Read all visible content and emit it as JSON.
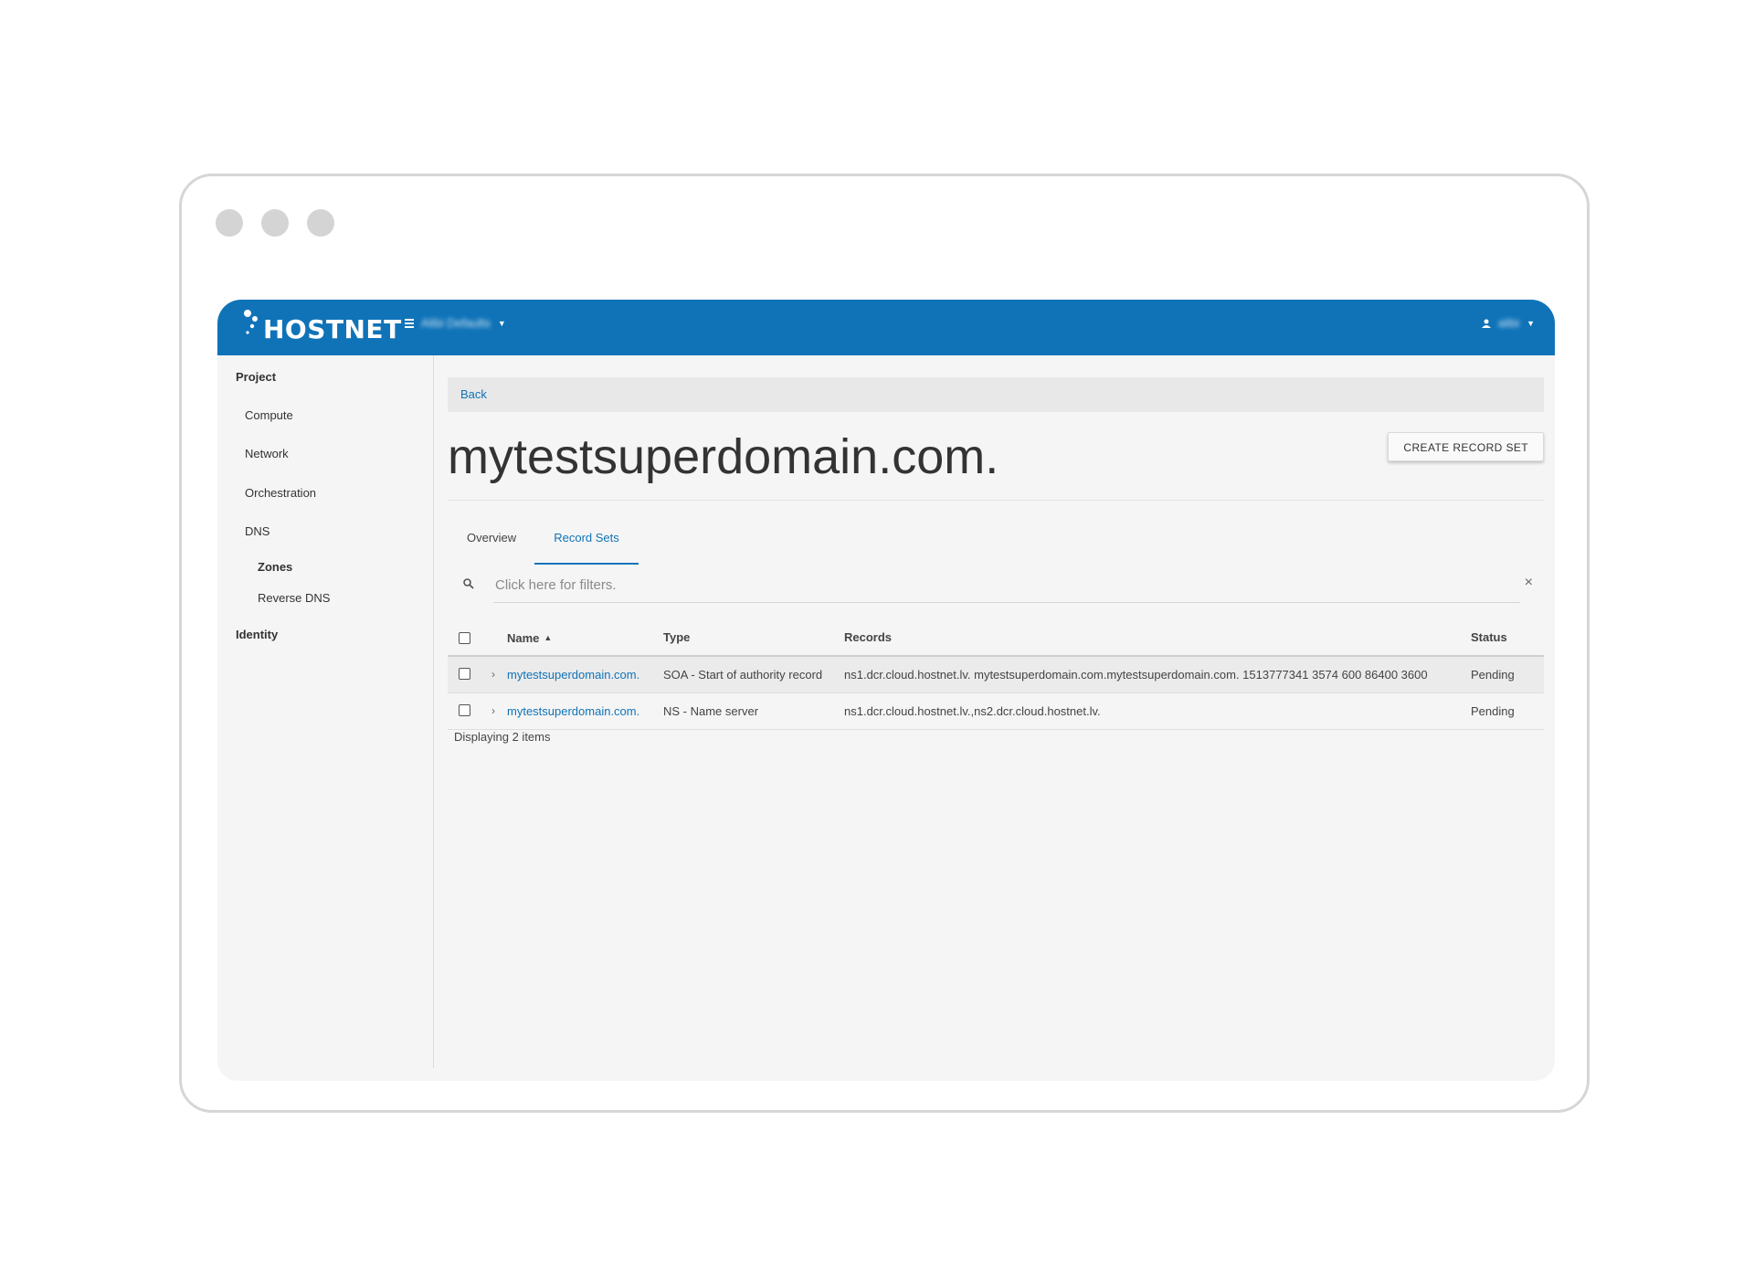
{
  "brand": {
    "name": "HOSTNET"
  },
  "topbar": {
    "project_label": "Alibi Defaults",
    "user_label": "alibi"
  },
  "sidebar": {
    "section_project": "Project",
    "items": [
      "Compute",
      "Network",
      "Orchestration",
      "DNS"
    ],
    "dns_children": [
      "Zones",
      "Reverse DNS"
    ],
    "section_identity": "Identity"
  },
  "breadcrumb": {
    "back": "Back"
  },
  "page": {
    "title": "mytestsuperdomain.com.",
    "create_button": "CREATE RECORD SET"
  },
  "tabs": [
    "Overview",
    "Record Sets"
  ],
  "filter": {
    "placeholder": "Click here for filters."
  },
  "table": {
    "columns": [
      "Name",
      "Type",
      "Records",
      "Status"
    ],
    "rows": [
      {
        "name": "mytestsuperdomain.com.",
        "type": "SOA - Start of authority record",
        "records": "ns1.dcr.cloud.hostnet.lv. mytestsuperdomain.com.mytestsuperdomain.com. 1513777341 3574 600 86400 3600",
        "status": "Pending"
      },
      {
        "name": "mytestsuperdomain.com.",
        "type": "NS - Name server",
        "records": "ns1.dcr.cloud.hostnet.lv.,ns2.dcr.cloud.hostnet.lv.",
        "status": "Pending"
      }
    ],
    "footer": "Displaying 2 items"
  },
  "colors": {
    "brand": "#1073b8",
    "background": "#f5f5f5"
  }
}
